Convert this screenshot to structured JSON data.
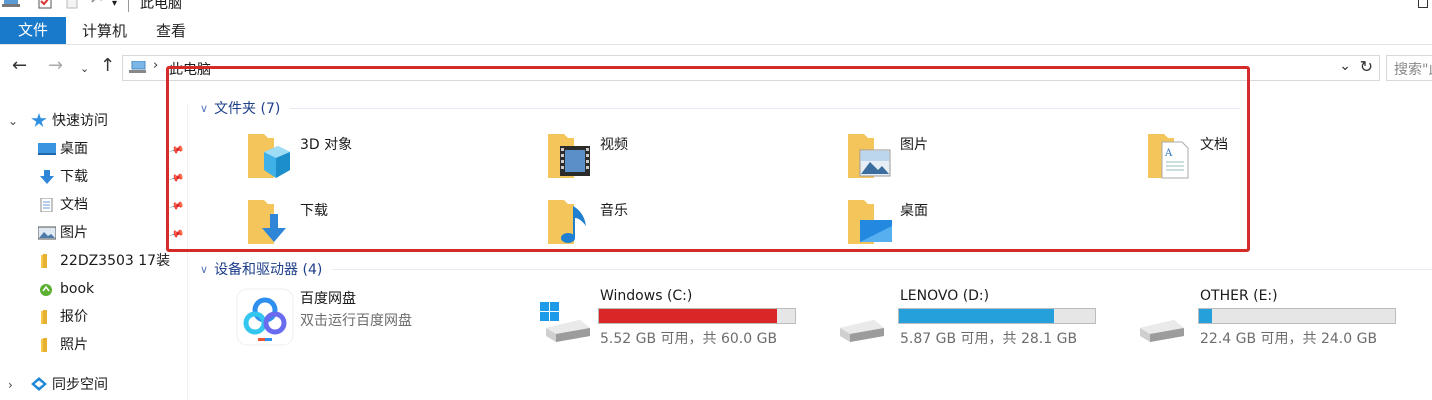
{
  "window": {
    "title": "此电脑"
  },
  "ribbon": {
    "tabs": [
      "文件",
      "计算机",
      "查看"
    ]
  },
  "address": {
    "path": "此电脑",
    "search_placeholder": "搜索\"此"
  },
  "sidebar": {
    "quick_access": "快速访问",
    "items": [
      {
        "label": "桌面",
        "icon": "desktop-icon",
        "pinned": true
      },
      {
        "label": "下载",
        "icon": "download-arrow-icon",
        "pinned": true
      },
      {
        "label": "文档",
        "icon": "document-icon",
        "pinned": true
      },
      {
        "label": "图片",
        "icon": "picture-icon",
        "pinned": true
      },
      {
        "label": "22DZ3503 17装",
        "icon": "folder-icon",
        "pinned": false
      },
      {
        "label": "book",
        "icon": "green-folder-icon",
        "pinned": false
      },
      {
        "label": "报价",
        "icon": "folder-icon",
        "pinned": false
      },
      {
        "label": "照片",
        "icon": "folder-icon",
        "pinned": false
      }
    ],
    "sync": "同步空间"
  },
  "folders_section": {
    "title": "文件夹 (7)",
    "items": [
      {
        "name": "3D 对象",
        "icon": "3d-objects-folder-icon"
      },
      {
        "name": "视频",
        "icon": "videos-folder-icon"
      },
      {
        "name": "图片",
        "icon": "pictures-folder-icon"
      },
      {
        "name": "文档",
        "icon": "documents-folder-icon"
      },
      {
        "name": "下载",
        "icon": "downloads-folder-icon"
      },
      {
        "name": "音乐",
        "icon": "music-folder-icon"
      },
      {
        "name": "桌面",
        "icon": "desktop-folder-icon"
      }
    ]
  },
  "devices_section": {
    "title": "设备和驱动器 (4)",
    "app": {
      "name": "百度网盘",
      "desc": "双击运行百度网盘",
      "icon": "baidu-netdisk-icon"
    },
    "drives": [
      {
        "name": "Windows (C:)",
        "info": "5.52 GB 可用，共 60.0 GB",
        "used_fraction": 0.908,
        "bar_color": "#da2626",
        "icon": "windows-drive-icon"
      },
      {
        "name": "LENOVO (D:)",
        "info": "5.87 GB 可用，共 28.1 GB",
        "used_fraction": 0.791,
        "bar_color": "#26a0da",
        "icon": "drive-icon"
      },
      {
        "name": "OTHER (E:)",
        "info": "22.4 GB 可用，共 24.0 GB",
        "used_fraction": 0.067,
        "bar_color": "#26a0da",
        "icon": "drive-icon"
      }
    ]
  },
  "colors": {
    "accent": "#1979ca",
    "highlight_border": "#d42a2a",
    "section_title": "#1e3f8a"
  }
}
